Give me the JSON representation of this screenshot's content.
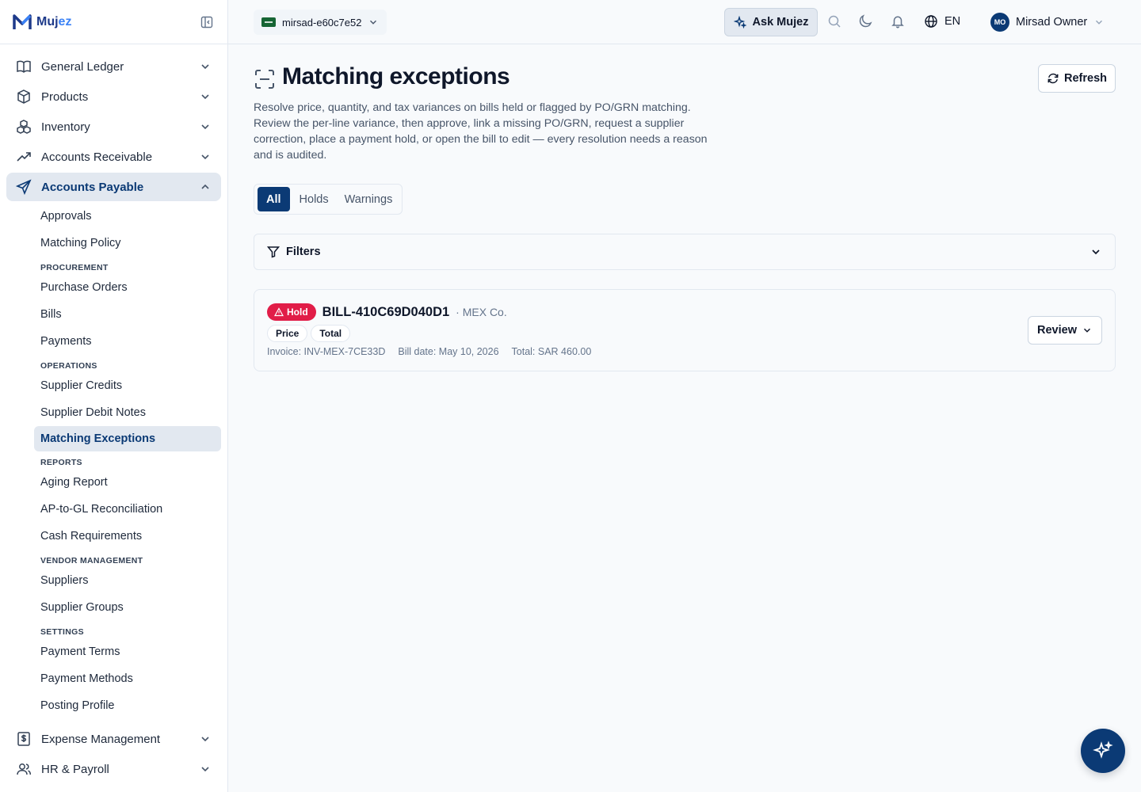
{
  "app": {
    "name_main": "Muj",
    "name_accent": "ez"
  },
  "sidebar": {
    "main_items": [
      {
        "label": "General Ledger",
        "icon": "book-icon"
      },
      {
        "label": "Products",
        "icon": "box-icon"
      },
      {
        "label": "Inventory",
        "icon": "boxes-icon"
      },
      {
        "label": "Accounts Receivable",
        "icon": "trending-up-icon"
      },
      {
        "label": "Accounts Payable",
        "icon": "send-icon"
      }
    ],
    "ap_sub": {
      "approvals": "Approvals",
      "matching_policy": "Matching Policy",
      "procurement_head": "PROCUREMENT",
      "purchase_orders": "Purchase Orders",
      "bills": "Bills",
      "payments": "Payments",
      "operations_head": "OPERATIONS",
      "supplier_credits": "Supplier Credits",
      "supplier_debit_notes": "Supplier Debit Notes",
      "matching_exceptions": "Matching Exceptions",
      "reports_head": "REPORTS",
      "aging_report": "Aging Report",
      "ap_gl_recon": "AP-to-GL Reconciliation",
      "cash_requirements": "Cash Requirements",
      "vendor_head": "VENDOR MANAGEMENT",
      "suppliers": "Suppliers",
      "supplier_groups": "Supplier Groups",
      "settings_head": "SETTINGS",
      "payment_terms": "Payment Terms",
      "payment_methods": "Payment Methods",
      "posting_profile": "Posting Profile"
    },
    "bottom_items": [
      {
        "label": "Expense Management",
        "icon": "receipt-icon"
      },
      {
        "label": "HR & Payroll",
        "icon": "users-icon"
      }
    ]
  },
  "topbar": {
    "company": "mirsad-e60c7e52",
    "ask_label": "Ask Mujez",
    "language": "EN",
    "user_initials": "MO",
    "user_name": "Mirsad Owner"
  },
  "page": {
    "title": "Matching exceptions",
    "refresh_label": "Refresh",
    "description": "Resolve price, quantity, and tax variances on bills held or flagged by PO/GRN matching. Review the per-line variance, then approve, link a missing PO/GRN, request a supplier correction, place a payment hold, or open the bill to edit — every resolution needs a reason and is audited.",
    "tabs": [
      "All",
      "Holds",
      "Warnings"
    ],
    "active_tab": "All",
    "filters_label": "Filters"
  },
  "exceptions": [
    {
      "status": "Hold",
      "bill_id": "BILL-410C69D040D1",
      "vendor": "· MEX Co.",
      "variances": [
        "Price",
        "Total"
      ],
      "invoice": "Invoice: INV-MEX-7CE33D",
      "bill_date": "Bill date: May 10, 2026",
      "total": "Total: SAR 460.00",
      "action_label": "Review"
    }
  ],
  "colors": {
    "brand": "#0b3a75",
    "hold": "#e11d48",
    "accent": "#3b82f6"
  }
}
